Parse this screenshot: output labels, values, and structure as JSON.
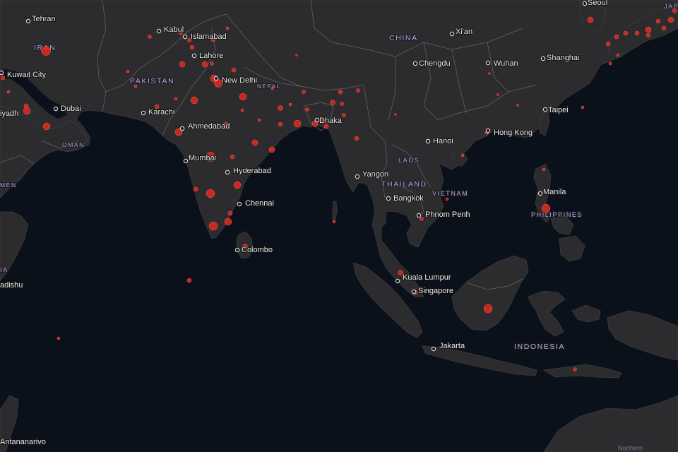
{
  "map": {
    "country_labels": [
      {
        "key": "iran",
        "text": "IRAN"
      },
      {
        "key": "pakistan",
        "text": "PAKISTAN"
      },
      {
        "key": "nepal",
        "text": "NEPAL"
      },
      {
        "key": "china",
        "text": "CHINA"
      },
      {
        "key": "oman",
        "text": "OMAN"
      },
      {
        "key": "yemen",
        "text": "MEN"
      },
      {
        "key": "laos",
        "text": "LAOS"
      },
      {
        "key": "thailand",
        "text": "THAILAND"
      },
      {
        "key": "vietnam",
        "text": "VIETNAM"
      },
      {
        "key": "philippines",
        "text": "PHILIPPINES"
      },
      {
        "key": "indonesia",
        "text": "INDONESIA"
      },
      {
        "key": "somalia",
        "text": "IA"
      },
      {
        "key": "japan",
        "text": "JAP"
      }
    ],
    "cities": [
      {
        "key": "tehran",
        "text": "Tehran"
      },
      {
        "key": "kabul",
        "text": "Kabul"
      },
      {
        "key": "islamabad",
        "text": "Islamabad"
      },
      {
        "key": "lahore",
        "text": "Lahore"
      },
      {
        "key": "new-delhi",
        "text": "New Delhi"
      },
      {
        "key": "kuwait-city",
        "text": "Kuwait City"
      },
      {
        "key": "riyadh",
        "text": "iyadh"
      },
      {
        "key": "dubai",
        "text": "Dubai"
      },
      {
        "key": "karachi",
        "text": "Karachi"
      },
      {
        "key": "ahmedabad",
        "text": "Ahmedabad"
      },
      {
        "key": "mumbai",
        "text": "Mumbai"
      },
      {
        "key": "hyderabad",
        "text": "Hyderabad"
      },
      {
        "key": "chennai",
        "text": "Chennai"
      },
      {
        "key": "colombo",
        "text": "Colombo"
      },
      {
        "key": "dhaka",
        "text": "Dhaka"
      },
      {
        "key": "yangon",
        "text": "Yangon"
      },
      {
        "key": "bangkok",
        "text": "Bangkok"
      },
      {
        "key": "hanoi",
        "text": "Hanoi"
      },
      {
        "key": "phnom-penh",
        "text": "Phnom Penh"
      },
      {
        "key": "kuala-lumpur",
        "text": "Kuala Lumpur"
      },
      {
        "key": "singapore",
        "text": "Singapore"
      },
      {
        "key": "jakarta",
        "text": "Jakarta"
      },
      {
        "key": "manila",
        "text": "Manila"
      },
      {
        "key": "hong-kong",
        "text": "Hong Kong"
      },
      {
        "key": "taipei",
        "text": "Taipei"
      },
      {
        "key": "shanghai",
        "text": "Shanghai"
      },
      {
        "key": "wuhan",
        "text": "Wuhan"
      },
      {
        "key": "chengdu",
        "text": "Chengdu"
      },
      {
        "key": "xian",
        "text": "Xi'an"
      },
      {
        "key": "seoul",
        "text": "Seoul"
      },
      {
        "key": "mogadishu",
        "text": "adishu"
      },
      {
        "key": "antananarivo",
        "text": "Antananarivo"
      },
      {
        "key": "northern",
        "text": "Northern"
      }
    ],
    "colors": {
      "ocean": "#0b111b",
      "land": "#2c2c2e",
      "border": "#7a7a7f",
      "bubble": "#e02a20",
      "country_label": "#b9a3e8",
      "city_label": "#e8e8e8"
    }
  }
}
